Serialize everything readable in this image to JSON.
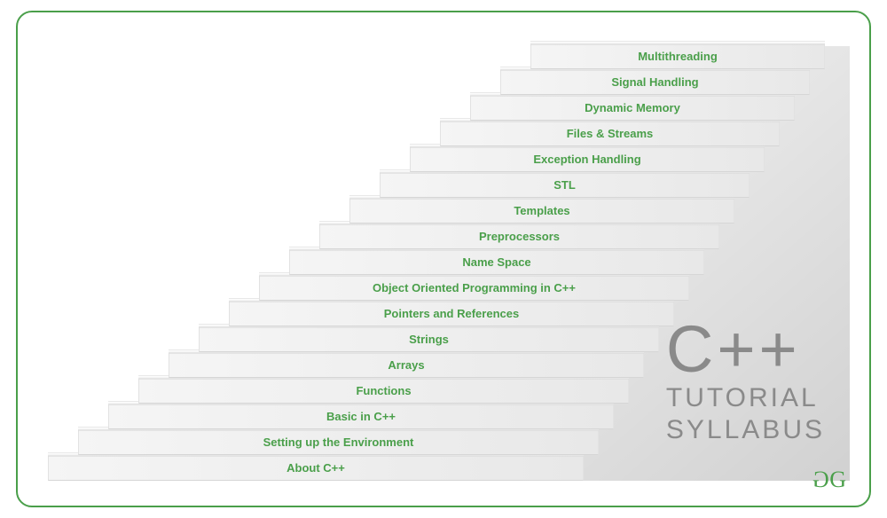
{
  "frame": {
    "border_color": "#4a9f4a"
  },
  "steps": [
    {
      "label": "About C++",
      "indent": 0
    },
    {
      "label": "Setting up the Environment",
      "indent": 34
    },
    {
      "label": "Basic in C++",
      "indent": 68
    },
    {
      "label": "Functions",
      "indent": 102
    },
    {
      "label": "Arrays",
      "indent": 136
    },
    {
      "label": "Strings",
      "indent": 170
    },
    {
      "label": "Pointers and References",
      "indent": 204
    },
    {
      "label": "Object Oriented Programming in C++",
      "indent": 238
    },
    {
      "label": "Name Space",
      "indent": 272
    },
    {
      "label": "Preprocessors",
      "indent": 306
    },
    {
      "label": "Templates",
      "indent": 340
    },
    {
      "label": "STL",
      "indent": 374
    },
    {
      "label": "Exception Handling",
      "indent": 408
    },
    {
      "label": "Files & Streams",
      "indent": 442
    },
    {
      "label": "Dynamic Memory",
      "indent": 476
    },
    {
      "label": "Signal Handling",
      "indent": 510
    },
    {
      "label": "Multithreading",
      "indent": 544
    }
  ],
  "title": {
    "main": "C++",
    "sub1": "TUTORIAL",
    "sub2": "SYLLABUS"
  },
  "logo": {
    "left": "G",
    "right": "G"
  },
  "colors": {
    "accent": "#4a9f4a",
    "step_text": "#4a9f4a",
    "title_text": "#8a8a8a"
  }
}
